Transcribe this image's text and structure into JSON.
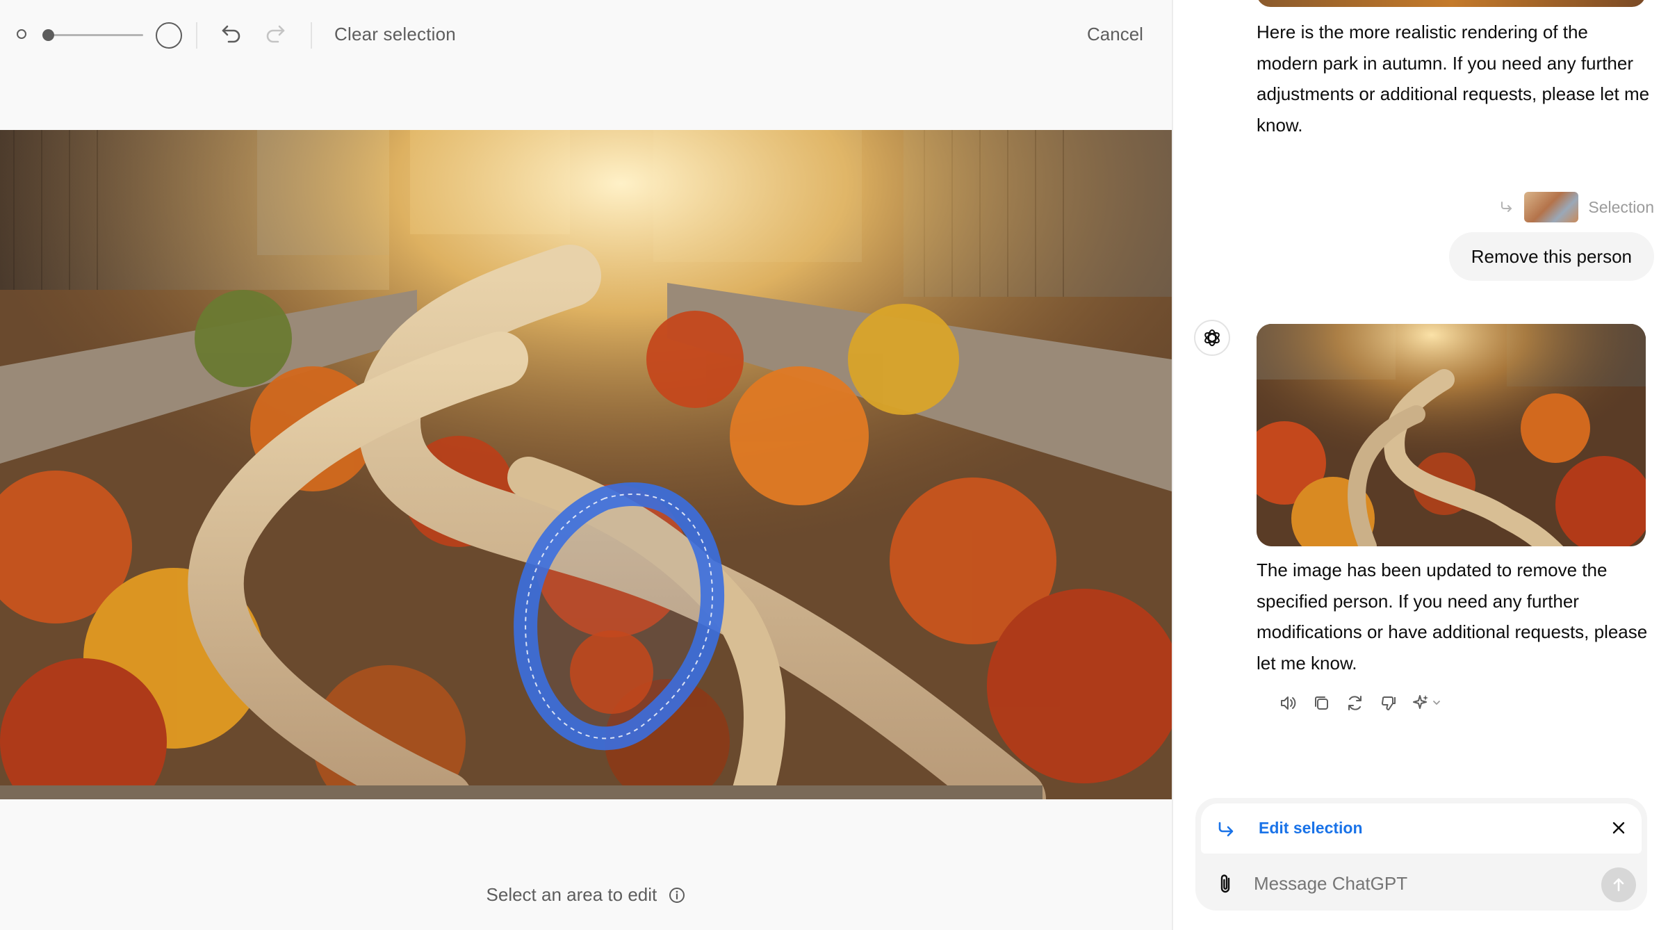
{
  "toolbar": {
    "clear_selection_label": "Clear selection",
    "cancel_label": "Cancel",
    "brush_size_fraction": 0.05
  },
  "canvas": {
    "hint": "Select an area to edit"
  },
  "chat": {
    "assistant_message_1": "Here is the more realistic rendering of the modern park in autumn. If you need any further adjustments or additional requests, please let me know.",
    "selection_label": "Selection",
    "user_message": "Remove this person",
    "assistant_message_2": "The image has been updated to remove the specified person. If you need any further modifications or have additional requests, please let me know.",
    "actions": [
      "speaker-icon",
      "copy-icon",
      "regenerate-icon",
      "thumbs-down-icon",
      "sparkle-icon"
    ]
  },
  "composer": {
    "edit_selection_label": "Edit selection",
    "placeholder": "Message ChatGPT"
  },
  "colors": {
    "accent_blue": "#1a73e8",
    "selection_stroke": "#3b6fe0",
    "muted_text": "#5d5d5d"
  }
}
